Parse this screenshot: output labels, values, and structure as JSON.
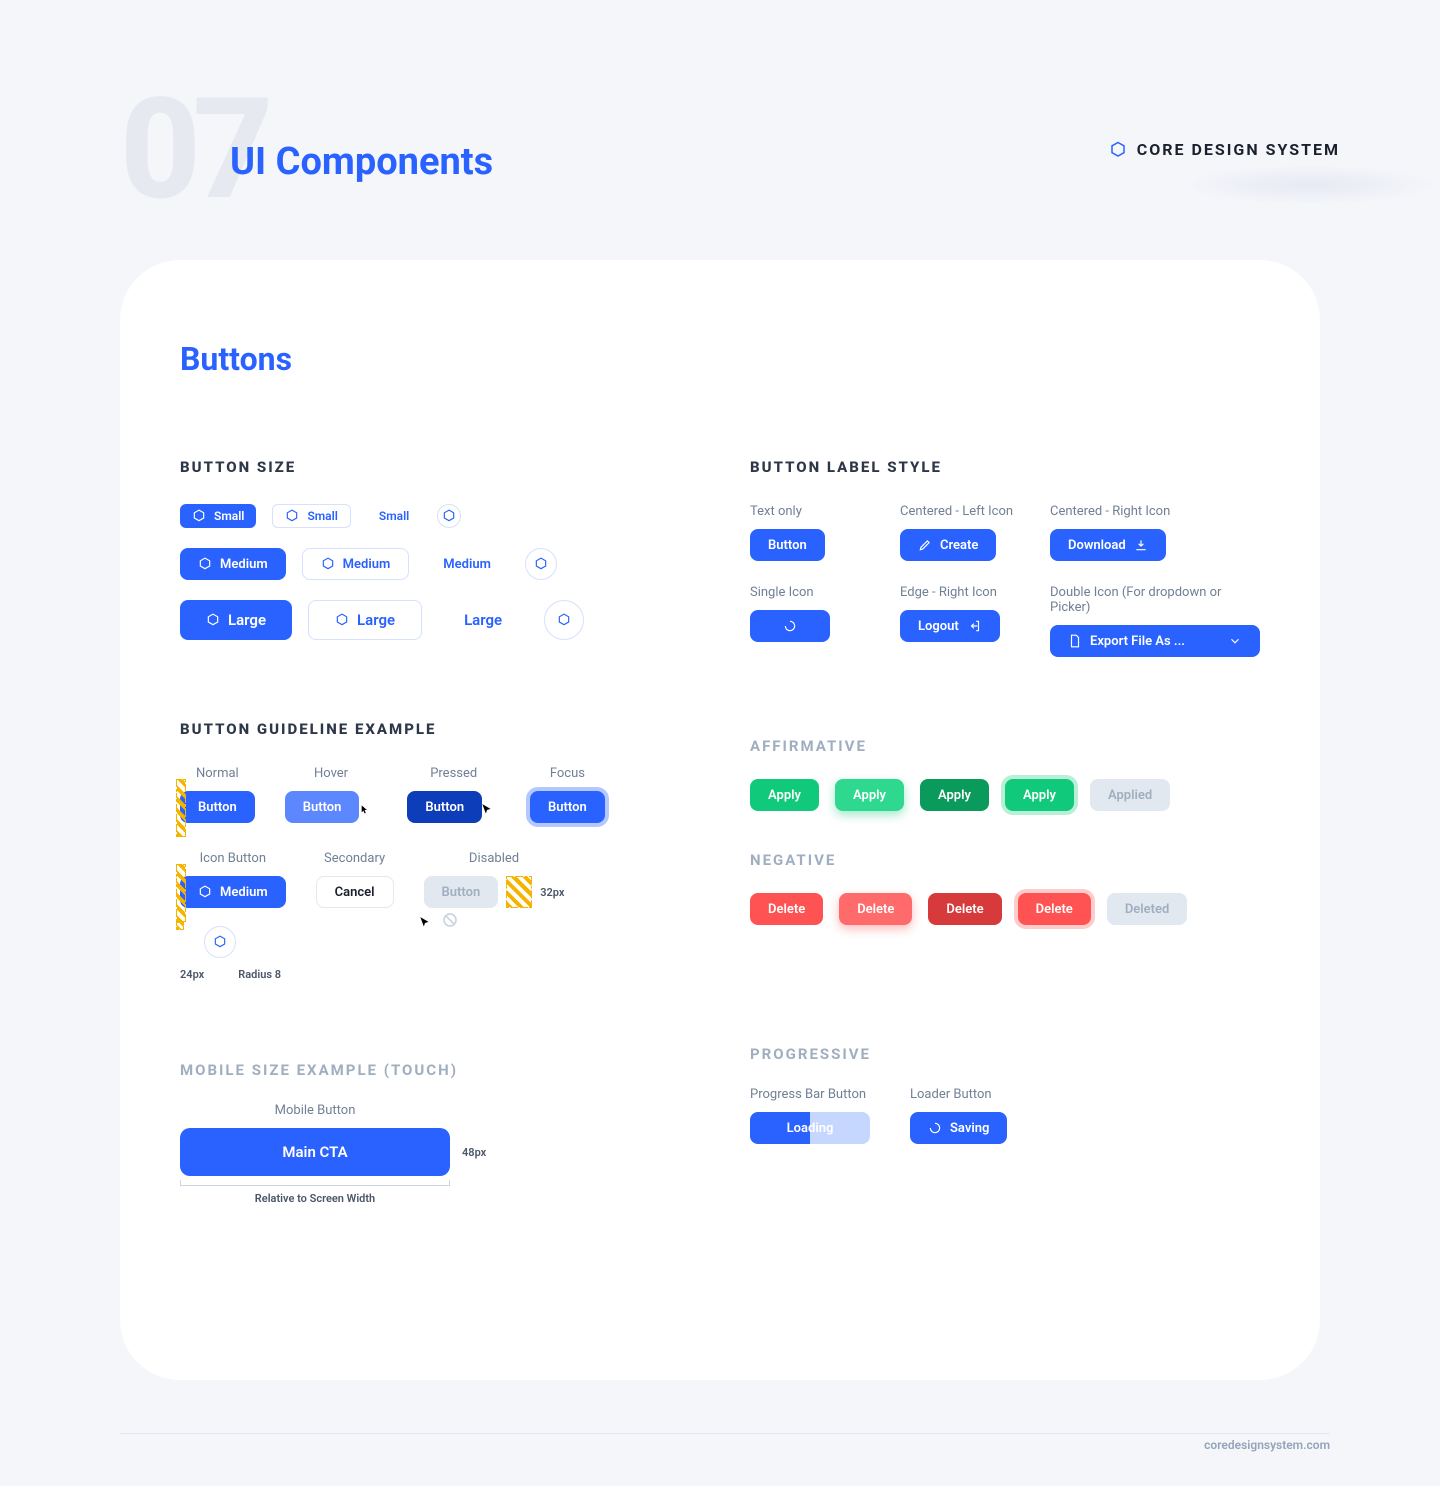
{
  "section_number": "07",
  "page_title": "UI Components",
  "brand_label": "CORE DESIGN SYSTEM",
  "card_title": "Buttons",
  "button_size": {
    "heading": "BUTTON SIZE",
    "small": "Small",
    "medium": "Medium",
    "large": "Large"
  },
  "label_style": {
    "heading": "BUTTON LABEL STYLE",
    "text_only": "Text only",
    "centered_left": "Centered - Left Icon",
    "centered_right": "Centered - Right Icon",
    "single_icon": "Single Icon",
    "edge_right": "Edge - Right Icon",
    "double_icon": "Double Icon (For dropdown or Picker)",
    "btn_button": "Button",
    "btn_create": "Create",
    "btn_download": "Download",
    "btn_logout": "Logout",
    "btn_export": "Export File As ..."
  },
  "guideline": {
    "heading": "BUTTON GUIDELINE EXAMPLE",
    "states": {
      "normal": "Normal",
      "hover": "Hover",
      "pressed": "Pressed",
      "focus": "Focus",
      "icon_button": "Icon Button",
      "secondary": "Secondary",
      "disabled": "Disabled"
    },
    "btn_button": "Button",
    "btn_medium": "Medium",
    "btn_cancel": "Cancel",
    "ann_24px": "24px",
    "ann_radius8": "Radius 8",
    "ann_32px": "32px"
  },
  "affirmative": {
    "heading": "AFFIRMATIVE",
    "apply": "Apply",
    "applied": "Applied"
  },
  "negative": {
    "heading": "NEGATIVE",
    "delete": "Delete",
    "deleted": "Deleted"
  },
  "mobile": {
    "heading": "MOBILE SIZE EXAMPLE (TOUCH)",
    "label": "Mobile Button",
    "cta": "Main CTA",
    "ann_48px": "48px",
    "ann_width": "Relative to Screen Width"
  },
  "progressive": {
    "heading": "PROGRESSIVE",
    "progress_label": "Progress Bar Button",
    "loader_label": "Loader Button",
    "loading": "Loading",
    "saving": "Saving"
  },
  "footer_url": "coredesignsystem.com"
}
